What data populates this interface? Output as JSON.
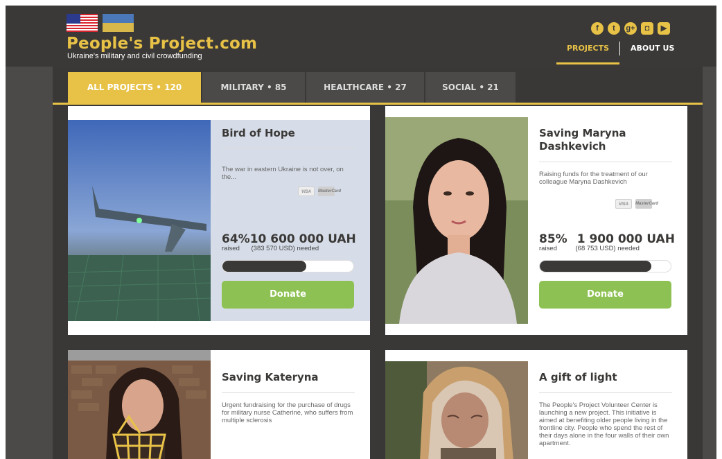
{
  "header": {
    "logo_title": "People's Project.com",
    "logo_subtitle": "Ukraine's military and civil crowdfunding",
    "nav": [
      {
        "label": "PROJECTS",
        "active": true
      },
      {
        "label": "ABOUT US",
        "active": false
      }
    ],
    "social": [
      {
        "icon": "facebook-icon",
        "glyph": "f"
      },
      {
        "icon": "twitter-icon",
        "glyph": "t"
      },
      {
        "icon": "google-plus-icon",
        "glyph": "g+"
      },
      {
        "icon": "instagram-icon",
        "glyph": "◘"
      },
      {
        "icon": "youtube-icon",
        "glyph": "▶"
      }
    ]
  },
  "tabs": [
    {
      "label": "ALL PROJECTS • 120",
      "active": true
    },
    {
      "label": "MILITARY • 85",
      "active": false
    },
    {
      "label": "HEALTHCARE • 27",
      "active": false
    },
    {
      "label": "SOCIAL • 21",
      "active": false
    }
  ],
  "projects": [
    {
      "title": "Bird of Hope",
      "description": "The war in eastern Ukraine is not over, on the...",
      "percent": "64%",
      "amount": "10 600 000 UAH",
      "raised_label": "raised",
      "needed_label": "(383 570 USD) needed",
      "progress": 0.64,
      "donate_label": "Donate",
      "payment": [
        "VISA",
        "MasterCard"
      ]
    },
    {
      "title": "Saving Maryna Dashkevich",
      "description": "Raising funds for the treatment of our colleague Maryna Dashkevich",
      "percent": "85%",
      "amount": "1 900 000 UAH",
      "raised_label": "raised",
      "needed_label": "(68 753 USD) needed",
      "progress": 0.85,
      "donate_label": "Donate",
      "payment": [
        "VISA",
        "MasterCard"
      ]
    },
    {
      "title": "Saving Kateryna",
      "description": "Urgent fundraising for the purchase of drugs for military nurse Catherine, who suffers from multiple sclerosis"
    },
    {
      "title": "A gift of light",
      "description": "The People's Project Volunteer Center is launching a new project. This initiative is aimed at benefiting older people living in the frontline city. People who spend the rest of their days alone in the four walls of their own apartment."
    }
  ],
  "colors": {
    "accent": "#e8c247",
    "dark": "#3b3937",
    "donate": "#8ec153"
  }
}
